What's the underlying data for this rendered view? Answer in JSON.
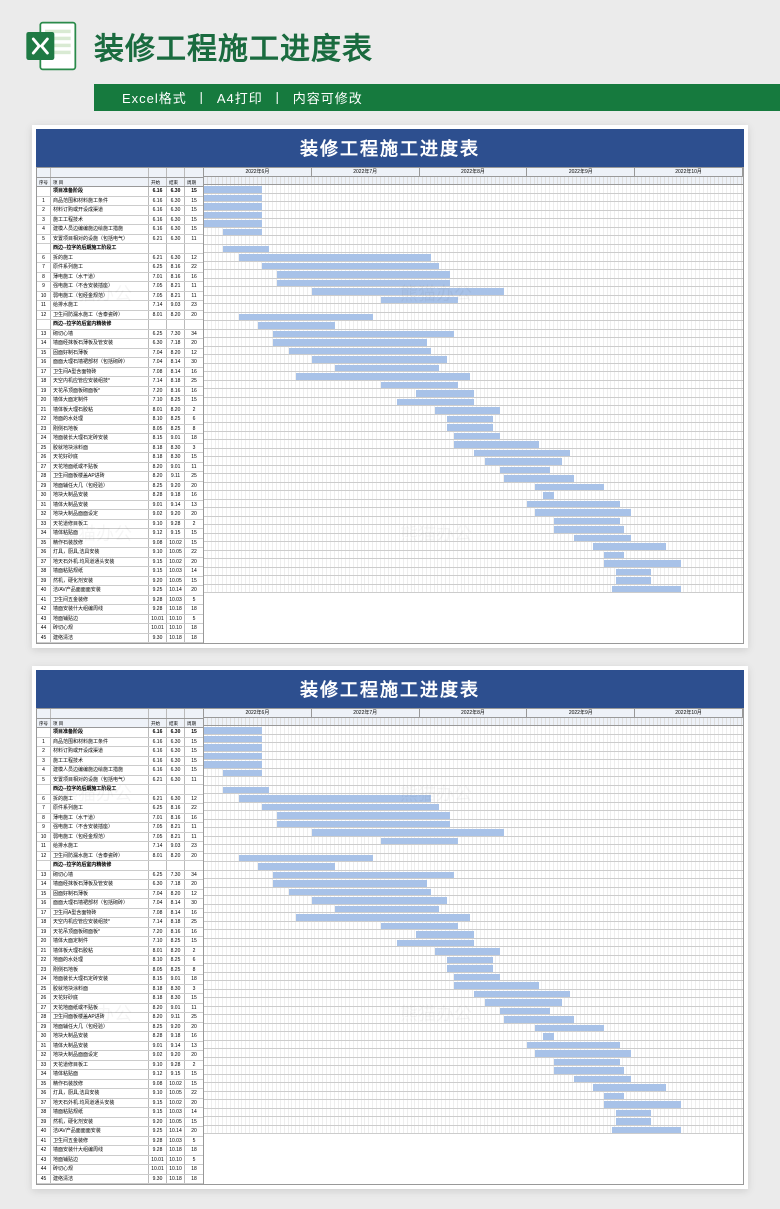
{
  "header": {
    "title": "装修工程施工进度表",
    "sub_format": "Excel格式",
    "sub_print": "A4打印",
    "sub_edit": "内容可修改",
    "sep": "丨"
  },
  "sheet": {
    "title": "装修工程施工进度表",
    "columns": {
      "seq": "序号",
      "name": "项    目",
      "start": "开始",
      "end": "结束",
      "dur": "周期"
    },
    "months": [
      "2022年6月",
      "2022年7月",
      "2022年8月",
      "2022年9月",
      "2022年10月"
    ]
  },
  "chart_data": {
    "type": "gantt",
    "title": "装修工程施工进度表",
    "x_range_days": 140,
    "months": [
      "2022年6月",
      "2022年7月",
      "2022年8月",
      "2022年9月",
      "2022年10月"
    ],
    "tasks": [
      {
        "seq": "",
        "name": "项目准备阶段",
        "start": "6.16",
        "end": "6.30",
        "dur": "15",
        "bold": true,
        "offset": 0,
        "len": 15
      },
      {
        "seq": "1",
        "name": "商品范围和材料施工条件",
        "start": "6.16",
        "end": "6.30",
        "dur": "15",
        "offset": 0,
        "len": 15
      },
      {
        "seq": "2",
        "name": "材料订购或开设成渠道",
        "start": "6.16",
        "end": "6.30",
        "dur": "15",
        "offset": 0,
        "len": 15
      },
      {
        "seq": "3",
        "name": "施工工程技术",
        "start": "6.16",
        "end": "6.30",
        "dur": "15",
        "offset": 0,
        "len": 15
      },
      {
        "seq": "4",
        "name": "建模人员边编编施边绘施工措施",
        "start": "6.16",
        "end": "6.30",
        "dur": "15",
        "offset": 0,
        "len": 15
      },
      {
        "seq": "5",
        "name": "安置项目相对的设施（包括电气）",
        "start": "6.21",
        "end": "6.30",
        "dur": "11",
        "offset": 5,
        "len": 10
      },
      {
        "seq": "",
        "name": "西边--拉字的后期施工阶段工",
        "start": "",
        "end": "",
        "dur": "",
        "bold": true
      },
      {
        "seq": "6",
        "name": "拆的施工",
        "start": "6.21",
        "end": "6.30",
        "dur": "12",
        "offset": 5,
        "len": 12
      },
      {
        "seq": "7",
        "name": "原件系列施工",
        "start": "6.25",
        "end": "8.16",
        "dur": "22",
        "offset": 9,
        "len": 50
      },
      {
        "seq": "8",
        "name": "薄电施工（水干道）",
        "start": "7.01",
        "end": "8.16",
        "dur": "16",
        "offset": 15,
        "len": 46
      },
      {
        "seq": "9",
        "name": "强电施工（不含安装插座）",
        "start": "7.05",
        "end": "8.21",
        "dur": "11",
        "offset": 19,
        "len": 45
      },
      {
        "seq": "10",
        "name": "弱电施工（包经金规范）",
        "start": "7.05",
        "end": "8.21",
        "dur": "11",
        "offset": 19,
        "len": 45
      },
      {
        "seq": "11",
        "name": "给排水施工",
        "start": "7.14",
        "end": "9.03",
        "dur": "23",
        "offset": 28,
        "len": 50
      },
      {
        "seq": "12",
        "name": "卫生间防漏水施工（含泰瓷砖）",
        "start": "8.01",
        "end": "8.20",
        "dur": "20",
        "offset": 46,
        "len": 20
      },
      {
        "seq": "",
        "name": "西边--拉字的后室内精装修",
        "start": "",
        "end": "",
        "dur": "",
        "bold": true
      },
      {
        "seq": "13",
        "name": "砌切心墙",
        "start": "6.25",
        "end": "7.30",
        "dur": "34",
        "offset": 9,
        "len": 35
      },
      {
        "seq": "14",
        "name": "墙面经抹板石薄板及管安装",
        "start": "6.30",
        "end": "7.18",
        "dur": "20",
        "offset": 14,
        "len": 20
      },
      {
        "seq": "15",
        "name": "固面好制石薄板",
        "start": "7.04",
        "end": "8.20",
        "dur": "12",
        "offset": 18,
        "len": 47
      },
      {
        "seq": "16",
        "name": "面面大理石墙裙部材（包括砌砖）",
        "start": "7.04",
        "end": "8.14",
        "dur": "30",
        "offset": 18,
        "len": 40
      },
      {
        "seq": "17",
        "name": "卫生间A型含面物砖",
        "start": "7.08",
        "end": "8.14",
        "dur": "16",
        "offset": 22,
        "len": 37
      },
      {
        "seq": "18",
        "name": "天空内机应管应安装组技*",
        "start": "7.14",
        "end": "8.18",
        "dur": "25",
        "offset": 28,
        "len": 35
      },
      {
        "seq": "19",
        "name": "天花吊顶面板砌面板*",
        "start": "7.20",
        "end": "8.16",
        "dur": "16",
        "offset": 34,
        "len": 27
      },
      {
        "seq": "20",
        "name": "墙体大面定制件",
        "start": "7.10",
        "end": "8.25",
        "dur": "15",
        "offset": 24,
        "len": 45
      },
      {
        "seq": "21",
        "name": "墙体板大理石胶粘",
        "start": "8.01",
        "end": "8.20",
        "dur": "2",
        "offset": 46,
        "len": 20
      },
      {
        "seq": "22",
        "name": "地面的水处理",
        "start": "8.10",
        "end": "8.25",
        "dur": "6",
        "offset": 55,
        "len": 15
      },
      {
        "seq": "23",
        "name": "刚侧石地板",
        "start": "8.05",
        "end": "8.25",
        "dur": "8",
        "offset": 50,
        "len": 20
      },
      {
        "seq": "24",
        "name": "地面装长大理石定砖安装",
        "start": "8.15",
        "end": "9.01",
        "dur": "18",
        "offset": 60,
        "len": 17
      },
      {
        "seq": "25",
        "name": "胶就地块涂料面",
        "start": "8.18",
        "end": "8.30",
        "dur": "3",
        "offset": 63,
        "len": 12
      },
      {
        "seq": "26",
        "name": "天花好砂底",
        "start": "8.18",
        "end": "8.30",
        "dur": "15",
        "offset": 63,
        "len": 12
      },
      {
        "seq": "27",
        "name": "天花地面纸或不贴板",
        "start": "8.20",
        "end": "9.01",
        "dur": "11",
        "offset": 65,
        "len": 12
      },
      {
        "seq": "28",
        "name": "卫生间面板楼盖AP进砖",
        "start": "8.20",
        "end": "9.11",
        "dur": "25",
        "offset": 65,
        "len": 22
      },
      {
        "seq": "29",
        "name": "地面辅任大几（包经验）",
        "start": "8.25",
        "end": "9.20",
        "dur": "20",
        "offset": 70,
        "len": 25
      },
      {
        "seq": "30",
        "name": "地块大制品安装",
        "start": "8.28",
        "end": "9.18",
        "dur": "16",
        "offset": 73,
        "len": 20
      },
      {
        "seq": "31",
        "name": "墙体大制品安装",
        "start": "9.01",
        "end": "9.14",
        "dur": "13",
        "offset": 77,
        "len": 13
      },
      {
        "seq": "32",
        "name": "地块大制品面面设定",
        "start": "9.02",
        "end": "9.20",
        "dur": "20",
        "offset": 78,
        "len": 18
      },
      {
        "seq": "33",
        "name": "天花道修目板工",
        "start": "9.10",
        "end": "9.28",
        "dur": "2",
        "offset": 86,
        "len": 18
      },
      {
        "seq": "34",
        "name": "墙体粘贴面",
        "start": "9.12",
        "end": "9.15",
        "dur": "15",
        "offset": 88,
        "len": 3
      },
      {
        "seq": "35",
        "name": "精作石装放修",
        "start": "9.08",
        "end": "10.02",
        "dur": "15",
        "offset": 84,
        "len": 24
      },
      {
        "seq": "36",
        "name": "灯具，厨具,洁具安装",
        "start": "9.10",
        "end": "10.05",
        "dur": "22",
        "offset": 86,
        "len": 25
      },
      {
        "seq": "37",
        "name": "地天石外机.均风道通头安装",
        "start": "9.15",
        "end": "10.02",
        "dur": "20",
        "offset": 91,
        "len": 17
      },
      {
        "seq": "38",
        "name": "墙面粘贴规纸",
        "start": "9.15",
        "end": "10.03",
        "dur": "14",
        "offset": 91,
        "len": 18
      },
      {
        "seq": "39",
        "name": "然机，硬化剂安装",
        "start": "9.20",
        "end": "10.05",
        "dur": "15",
        "offset": 96,
        "len": 15
      },
      {
        "seq": "40",
        "name": "洁/AV产品面面面安装",
        "start": "9.25",
        "end": "10.14",
        "dur": "20",
        "offset": 101,
        "len": 19
      },
      {
        "seq": "41",
        "name": "卫生间五金装修",
        "start": "9.28",
        "end": "10.03",
        "dur": "5",
        "offset": 104,
        "len": 5
      },
      {
        "seq": "42",
        "name": "墙面安装什大组编周线",
        "start": "9.28",
        "end": "10.18",
        "dur": "18",
        "offset": 104,
        "len": 20
      },
      {
        "seq": "43",
        "name": "地面铺贴边",
        "start": "10.01",
        "end": "10.10",
        "dur": "5",
        "offset": 107,
        "len": 9
      },
      {
        "seq": "44",
        "name": "砖切心规",
        "start": "10.01",
        "end": "10.10",
        "dur": "18",
        "offset": 107,
        "len": 9
      },
      {
        "seq": "45",
        "name": "建络清洁",
        "start": "9.30",
        "end": "10.18",
        "dur": "18",
        "offset": 106,
        "len": 18
      }
    ]
  },
  "watermark": "熊猫办公"
}
